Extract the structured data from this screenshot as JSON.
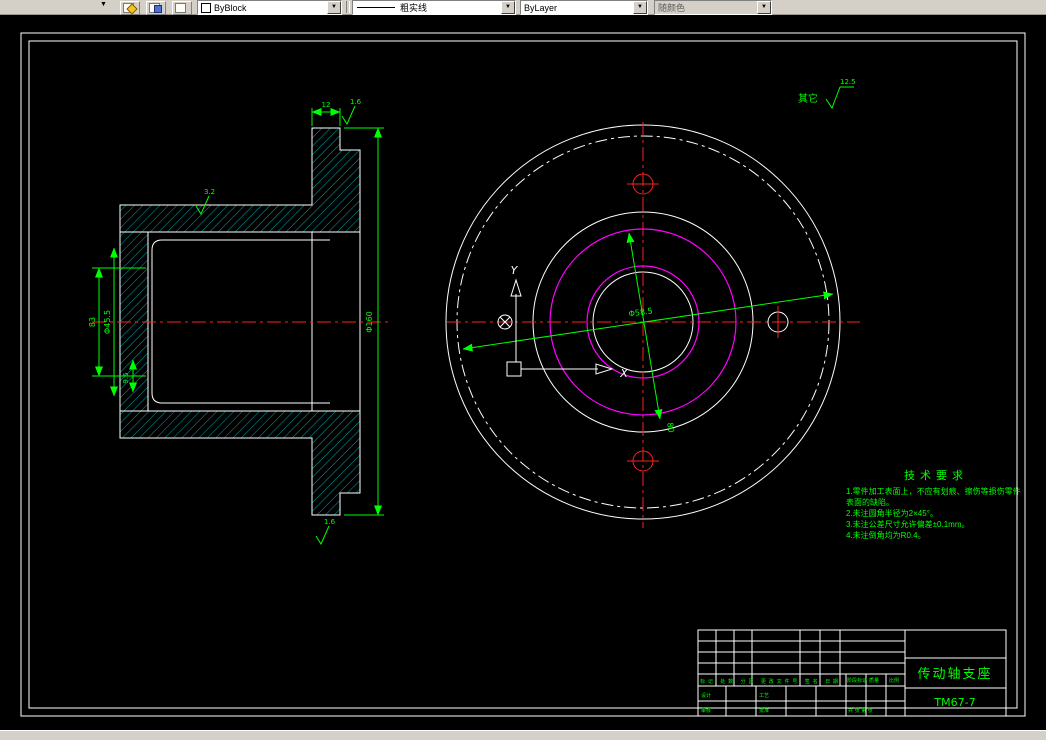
{
  "colors": {
    "outline": "#ffffff",
    "centerline": "#ff2020",
    "dimension": "#00ff00",
    "auxiliary": "#ff00ff",
    "hatch": "#00b4b4",
    "toolbar_bg": "#d4d0c8",
    "canvas_bg": "#000000"
  },
  "toolbar": {
    "overflow_arrow": "▼",
    "color_control": "ByBlock",
    "linetype_control": "粗实线",
    "lineweight_control": "ByLayer",
    "plotstyle_control": "随颜色"
  },
  "drawing": {
    "roughness_note": {
      "label": "其它",
      "value": "12.5"
    },
    "tech_requirements": {
      "title": "技术要求",
      "items": [
        "1.零件加工表面上，不应有划痕、擦伤等损伤零件表面的缺陷。",
        "2.未注圆角半径为2×45°。",
        "3.未注公差尺寸允许偏差±0.1mm。",
        "4.未注倒角均为R0.4。"
      ]
    },
    "section_view": {
      "dim_width": "12",
      "dim_bore_depth": "83",
      "dim_bore_dia": "Φ45.5",
      "dim_step": "9.5",
      "dim_flange_dia": "Φ160",
      "rough_top": "1.6",
      "rough_tube": "3.2",
      "rough_bottom": "1.6"
    },
    "front_view": {
      "dim_diagonal": "Φ58.5",
      "dim_bolt_circle": "80",
      "axis_x": "X",
      "axis_y": "Y"
    },
    "title_block": {
      "part_name": "传动轴支座",
      "drawing_no": "TM67-7",
      "rev_header": "标记 处数 分区 更改文件号 签名 日期",
      "cell_design": "设计",
      "cell_check": "工艺",
      "cell_audit": "审核",
      "cell_approve": "批准",
      "stage_label": "阶段标记",
      "weight_label": "质量",
      "scale_label": "比例",
      "sheet_label": "共 张 第 张"
    }
  }
}
